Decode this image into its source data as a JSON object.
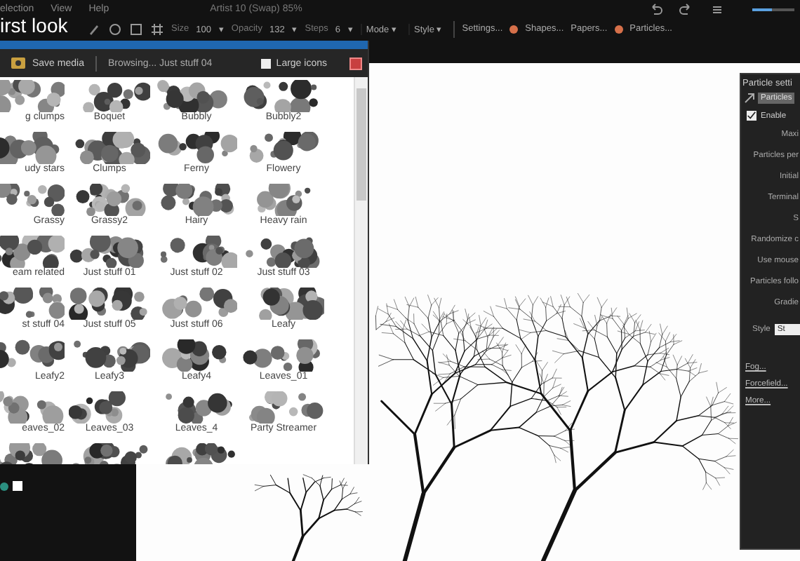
{
  "menu": [
    "election",
    "View",
    "Help"
  ],
  "window": {
    "title": "Artist 10 (Swap) 85%"
  },
  "zoom_slider": {
    "level": 0.45
  },
  "caption": "irst look",
  "toolbar": {
    "fields": [
      {
        "label": "Size",
        "value": "100",
        "caret": "▾"
      },
      {
        "label": "Opacity",
        "value": "132",
        "caret": "▾"
      },
      {
        "label": "Steps",
        "value": "6",
        "caret": "▾"
      }
    ],
    "dropdowns": [
      {
        "label": "Mode",
        "caret": "▾"
      },
      {
        "label": "Style",
        "caret": "▾"
      }
    ],
    "buttons": [
      {
        "label": "Settings...",
        "indicator": false
      },
      {
        "label": "Shapes...",
        "indicator": true
      },
      {
        "label": "Papers...",
        "indicator": false
      },
      {
        "label": "Particles...",
        "indicator": true
      }
    ]
  },
  "media_browser": {
    "save_button": "Save media",
    "path": "Browsing... Just stuff 04",
    "large_icons": {
      "label": "Large icons",
      "checked": false
    },
    "brushes": [
      {
        "label": "g clumps"
      },
      {
        "label": "Boquet"
      },
      {
        "label": "Bubbly"
      },
      {
        "label": "Bubbly2"
      },
      {
        "label": "udy stars"
      },
      {
        "label": "Clumps"
      },
      {
        "label": "Ferny"
      },
      {
        "label": "Flowery"
      },
      {
        "label": "Grassy"
      },
      {
        "label": "Grassy2"
      },
      {
        "label": "Hairy"
      },
      {
        "label": "Heavy rain"
      },
      {
        "label": "eam related"
      },
      {
        "label": "Just stuff 01"
      },
      {
        "label": "Just stuff 02"
      },
      {
        "label": "Just stuff 03"
      },
      {
        "label": "st stuff 04"
      },
      {
        "label": "Just stuff 05"
      },
      {
        "label": "Just stuff 06"
      },
      {
        "label": "Leafy"
      },
      {
        "label": "Leafy2"
      },
      {
        "label": "Leafy3"
      },
      {
        "label": "Leafy4"
      },
      {
        "label": "Leaves_01"
      },
      {
        "label": "eaves_02"
      },
      {
        "label": "Leaves_03"
      },
      {
        "label": "Leaves_4"
      },
      {
        "label": "Party Streamer"
      },
      {
        "kind": "picture"
      },
      {
        "kind": "picture"
      },
      {
        "kind": "picture"
      }
    ]
  },
  "particle_settings": {
    "title": "Particle setti",
    "tab": {
      "label": "Particles",
      "selected": true
    },
    "enable": {
      "label": "Enable",
      "checked": true
    },
    "labels": [
      "Maxi",
      "Particles per",
      "Initial",
      "Terminal",
      "S",
      "Randomize c",
      "Use mouse",
      "Particles follo",
      "Gradie"
    ],
    "style": {
      "label": "Style",
      "value": "St"
    },
    "links": [
      "Fog...",
      "Forcefield...",
      "More..."
    ]
  }
}
